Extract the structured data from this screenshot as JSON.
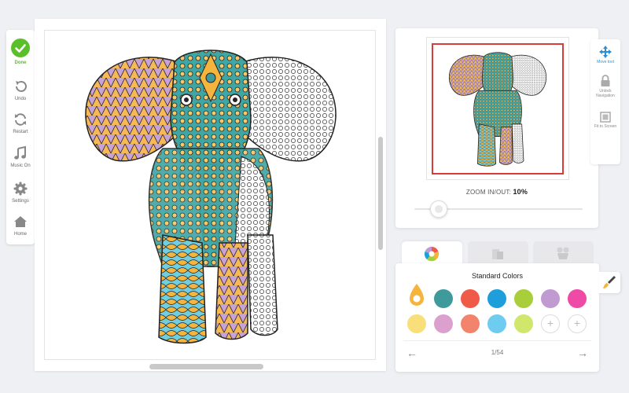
{
  "toolbar": {
    "done": "Done",
    "undo": "Undo",
    "restart": "Restart",
    "music": "Music On",
    "settings": "Settings",
    "home": "Home"
  },
  "navigator": {
    "zoom_label": "ZOOM IN/OUT:",
    "zoom_value": "10%"
  },
  "nav_tools": {
    "move": "Move tool",
    "unlock": "Unlock Navigation",
    "fit": "Fit to Screen"
  },
  "palette": {
    "title": "Standard Colors",
    "page": "1/54",
    "row1": [
      "#f5b43d",
      "#3f9a9c",
      "#f05a48",
      "#1e9fdc",
      "#a8cf3a",
      "#c19ad1",
      "#ee4aa6"
    ],
    "row2": [
      "#f8df7a",
      "#dca0cf",
      "#f2846b",
      "#6dccef",
      "#cfe86c"
    ],
    "add_label": "+"
  },
  "colors": {
    "done_green": "#5bbf2a",
    "accent_blue": "#2b8fd6",
    "view_red": "#d93a3a"
  }
}
